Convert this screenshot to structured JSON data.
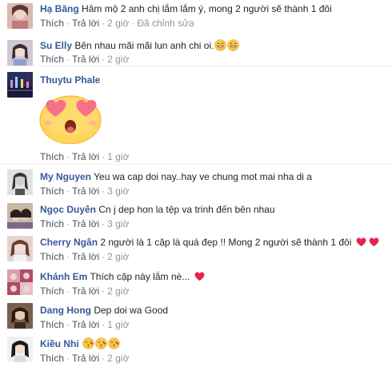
{
  "comments": [
    {
      "name": "Hạ Băng",
      "text": "Hâm mộ 2 anh chị lắm lắm ý, mong 2 người sẽ thành 1 đôi",
      "like": "Thích",
      "reply": "Trả lời",
      "time": "2 giờ",
      "edited": "Đã chỉnh sửa"
    },
    {
      "name": "Su Elly",
      "text": "Bên nhau mãi mãi lun anh chi oi.",
      "like": "Thích",
      "reply": "Trả lời",
      "time": "2 giờ"
    },
    {
      "name": "Thuytu Phale",
      "text": "",
      "like": "Thích",
      "reply": "Trả lời",
      "time": "1 giờ"
    },
    {
      "name": "My Nguyen",
      "text": "Yeu wa cap doi nay..hay ve chung mot mai nha di a",
      "like": "Thích",
      "reply": "Trả lời",
      "time": "3 giờ"
    },
    {
      "name": "Ngọc Duyên",
      "text": "Cn j dep hon la tệp va trinh đến bên nhau",
      "like": "Thích",
      "reply": "Trả lời",
      "time": "3 giờ"
    },
    {
      "name": "Cherry Ngân",
      "text": "2 người là 1 cặp là quá đẹp !! Mong 2 người sẽ thành 1 đôi",
      "like": "Thích",
      "reply": "Trả lời",
      "time": "2 giờ"
    },
    {
      "name": "Khánh Em",
      "text": "Thích cặp này lắm nè...",
      "like": "Thích",
      "reply": "Trả lời",
      "time": "2 giờ"
    },
    {
      "name": "Dang Hong",
      "text": "Dep doi wa Good",
      "like": "Thích",
      "reply": "Trả lời",
      "time": "1 giờ"
    },
    {
      "name": "Kiều Nhi",
      "text": "",
      "like": "Thích",
      "reply": "Trả lời",
      "time": "2 giờ"
    }
  ],
  "colors": {
    "name": "#365899",
    "meta": "#90949c",
    "heart": "#e2264d"
  },
  "icons": [
    "avatar",
    "grin-emoji",
    "heart-eyes-sticker",
    "heart-emoji",
    "kiss-emoji"
  ]
}
